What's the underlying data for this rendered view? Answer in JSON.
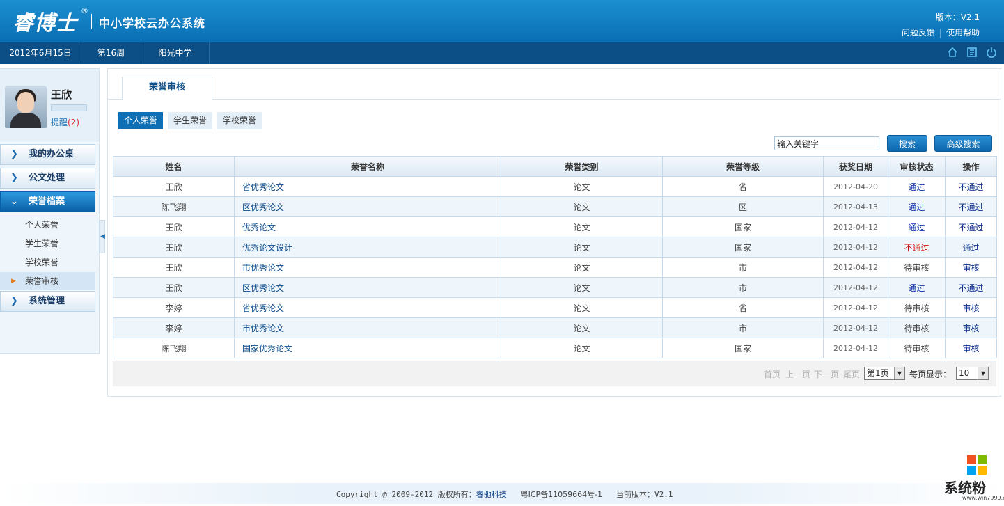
{
  "header": {
    "logo": "睿博士",
    "logo_reg": "®",
    "system_title": "中小学校云办公系统",
    "version": "版本：V2.1",
    "feedback_link": "问题反馈",
    "help_link": "使用帮助",
    "link_separator": "|"
  },
  "navbar": {
    "date": "2012年6月15日",
    "week": "第16周",
    "school": "阳光中学",
    "icons": [
      "home-icon",
      "book-icon",
      "power-icon"
    ]
  },
  "sidebar": {
    "user_name": "王欣",
    "remind_label": "提醒",
    "remind_count_text": "(2)",
    "menu": [
      {
        "label": "我的办公桌",
        "expanded": false
      },
      {
        "label": "公文处理",
        "expanded": false
      },
      {
        "label": "荣誉档案",
        "expanded": true
      },
      {
        "label": "系统管理",
        "expanded": false
      }
    ],
    "submenu": [
      "个人荣誉",
      "学生荣誉",
      "学校荣誉",
      "荣誉审核"
    ],
    "submenu_active": "荣誉审核"
  },
  "main": {
    "tab": "荣誉审核",
    "subtabs": [
      "个人荣誉",
      "学生荣誉",
      "学校荣誉"
    ],
    "subtab_active": "个人荣誉",
    "search_value": "输入关键字",
    "search_button": "搜索",
    "advanced_button": "高级搜索",
    "table": {
      "headers": [
        "姓名",
        "荣誉名称",
        "荣誉类别",
        "荣誉等级",
        "获奖日期",
        "审核状态",
        "操作"
      ],
      "rows": [
        {
          "name": "王欣",
          "title": "省优秀论文",
          "category": "论文",
          "level": "省",
          "date": "2012-04-20",
          "status": "通过",
          "status_type": "pass",
          "action": "不通过"
        },
        {
          "name": "陈飞翔",
          "title": "区优秀论文",
          "category": "论文",
          "level": "区",
          "date": "2012-04-13",
          "status": "通过",
          "status_type": "pass",
          "action": "不通过"
        },
        {
          "name": "王欣",
          "title": "优秀论文",
          "category": "论文",
          "level": "国家",
          "date": "2012-04-12",
          "status": "通过",
          "status_type": "pass",
          "action": "不通过"
        },
        {
          "name": "王欣",
          "title": "优秀论文设计",
          "category": "论文",
          "level": "国家",
          "date": "2012-04-12",
          "status": "不通过",
          "status_type": "fail",
          "action": "通过"
        },
        {
          "name": "王欣",
          "title": "市优秀论文",
          "category": "论文",
          "level": "市",
          "date": "2012-04-12",
          "status": "待审核",
          "status_type": "pending",
          "action": "审核"
        },
        {
          "name": "王欣",
          "title": "区优秀论文",
          "category": "论文",
          "level": "市",
          "date": "2012-04-12",
          "status": "通过",
          "status_type": "pass",
          "action": "不通过"
        },
        {
          "name": "李婷",
          "title": "省优秀论文",
          "category": "论文",
          "level": "省",
          "date": "2012-04-12",
          "status": "待审核",
          "status_type": "pending",
          "action": "审核"
        },
        {
          "name": "李婷",
          "title": "市优秀论文",
          "category": "论文",
          "level": "市",
          "date": "2012-04-12",
          "status": "待审核",
          "status_type": "pending",
          "action": "审核"
        },
        {
          "name": "陈飞翔",
          "title": "国家优秀论文",
          "category": "论文",
          "level": "国家",
          "date": "2012-04-12",
          "status": "待审核",
          "status_type": "pending",
          "action": "审核"
        }
      ]
    },
    "pager": {
      "first": "首页",
      "prev": "上一页",
      "next": "下一页",
      "last": "尾页",
      "page_select": "第1页",
      "per_page_label": "每页显示：",
      "per_page_value": "10"
    }
  },
  "footer": {
    "copyright": "Copyright @ 2009-2012",
    "owner_label": "版权所有：",
    "owner": "睿驰科技",
    "icp": "粤ICP备11059664号-1",
    "version_label": "当前版本：",
    "version": "V2.1"
  },
  "watermark": {
    "text": "系统粉",
    "url": "www.win7999.com"
  },
  "colors": {
    "header_blue": "#0a6eb4",
    "nav_dark": "#0b4f86",
    "pass": "#0b2fa8",
    "fail": "#d10d0d"
  }
}
